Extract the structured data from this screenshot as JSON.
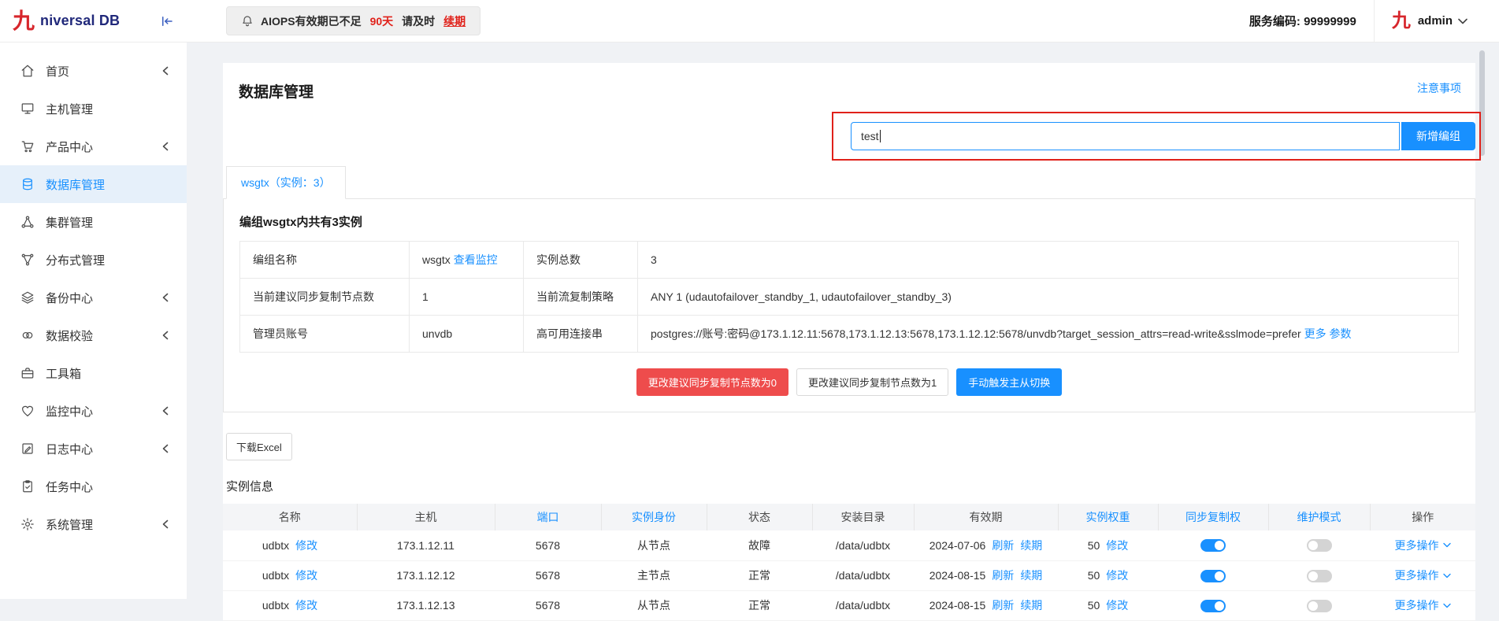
{
  "colors": {
    "accent": "#1890ff",
    "danger_button": "#ee4c4c",
    "alert_red": "#e0211a",
    "logo_red": "#d7262c",
    "sidebar_active_bg": "#e6f0fa"
  },
  "topbar": {
    "logo_glyph": "九",
    "brand": "niversal DB",
    "alert": {
      "prefix": "AIOPS有效期已不足",
      "days": "90天",
      "middle": "请及时",
      "renew": "续期"
    },
    "service_code": "服务编码: 99999999",
    "user_glyph": "九",
    "username": "admin"
  },
  "sidebar": {
    "items": [
      {
        "label": "首页"
      },
      {
        "label": "主机管理"
      },
      {
        "label": "产品中心"
      },
      {
        "label": "数据库管理"
      },
      {
        "label": "集群管理"
      },
      {
        "label": "分布式管理"
      },
      {
        "label": "备份中心"
      },
      {
        "label": "数据校验"
      },
      {
        "label": "工具箱"
      },
      {
        "label": "监控中心"
      },
      {
        "label": "日志中心"
      },
      {
        "label": "任务中心"
      },
      {
        "label": "系统管理"
      }
    ]
  },
  "main": {
    "page_title": "数据库管理",
    "notice_link": "注意事项",
    "group_input": {
      "value": "test"
    },
    "add_group_button": "新增编组",
    "tab": "wsgtx（实例：3）",
    "group_panel": {
      "title": "编组wsgtx内共有3实例",
      "info": {
        "r0c0": "编组名称",
        "r0c1": "wsgtx",
        "r0c1_link": "查看监控",
        "r0c2": "实例总数",
        "r0c3": "3",
        "r1c0": "当前建议同步复制节点数",
        "r1c1": "1",
        "r1c2": "当前流复制策略",
        "r1c3": "ANY 1 (udautofailover_standby_1, udautofailover_standby_3)",
        "r2c0": "管理员账号",
        "r2c1": "unvdb",
        "r2c2": "高可用连接串",
        "r2c3": "postgres://账号:密码@173.1.12.11:5678,173.1.12.13:5678,173.1.12.12:5678/unvdb?target_session_attrs=read-write&sslmode=prefer",
        "more_link": "更多",
        "params_link": "参数"
      },
      "buttons": {
        "set_zero": "更改建议同步复制节点数为0",
        "set_one": "更改建议同步复制节点数为1",
        "manual_switch": "手动触发主从切换"
      }
    },
    "download_excel": "下载Excel",
    "instances_title": "实例信息",
    "table": {
      "headers": [
        "名称",
        "主机",
        "端口",
        "实例身份",
        "状态",
        "安装目录",
        "有效期",
        "实例权重",
        "同步复制权",
        "维护模式",
        "操作"
      ],
      "links": {
        "edit": "修改",
        "refresh": "刷新",
        "renew": "续期",
        "more": "更多操作"
      },
      "rows": [
        {
          "name": "udbtx",
          "host": "173.1.12.11",
          "port": "5678",
          "role": "从节点",
          "status": "故障",
          "dir": "/data/udbtx",
          "expiry": "2024-07-06",
          "weight": "50",
          "sync_on": true,
          "maint_on": false
        },
        {
          "name": "udbtx",
          "host": "173.1.12.12",
          "port": "5678",
          "role": "主节点",
          "status": "正常",
          "dir": "/data/udbtx",
          "expiry": "2024-08-15",
          "weight": "50",
          "sync_on": true,
          "maint_on": false
        },
        {
          "name": "udbtx",
          "host": "173.1.12.13",
          "port": "5678",
          "role": "从节点",
          "status": "正常",
          "dir": "/data/udbtx",
          "expiry": "2024-08-15",
          "weight": "50",
          "sync_on": true,
          "maint_on": false
        }
      ]
    }
  }
}
